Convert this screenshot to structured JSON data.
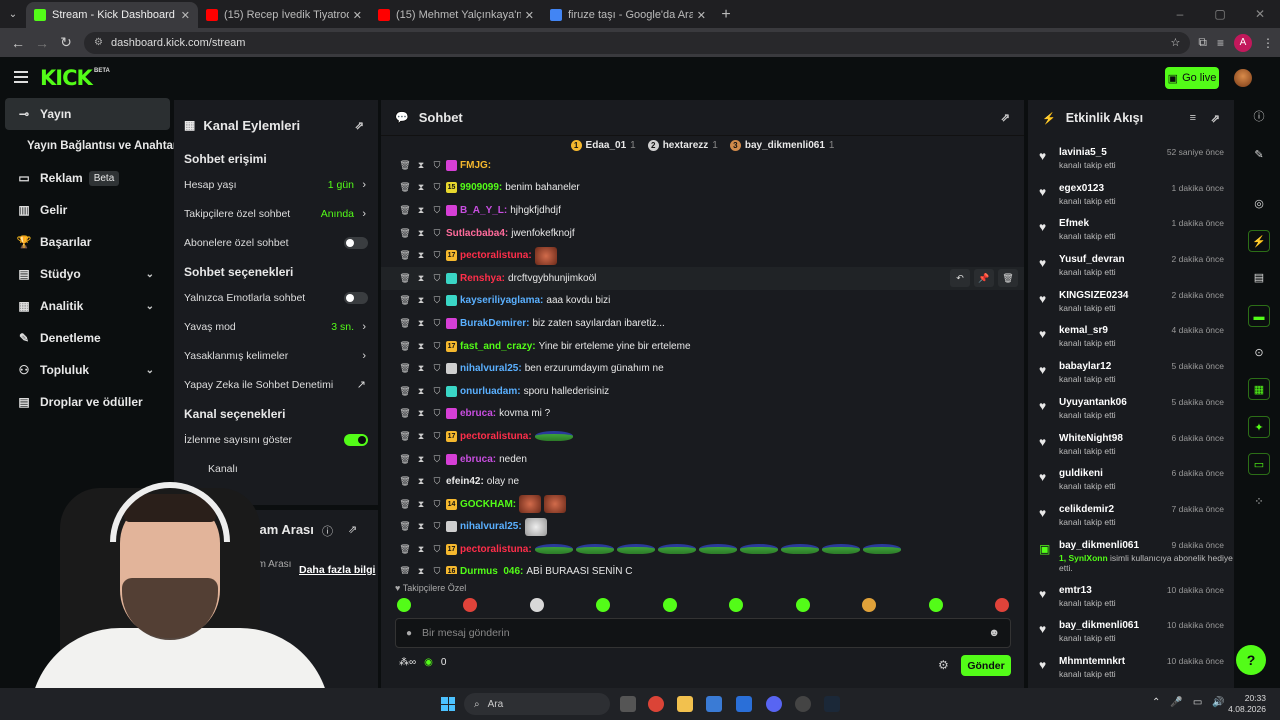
{
  "browser": {
    "tabs": [
      {
        "title": "Stream - Kick Dashboard",
        "color": "#53fc18",
        "active": true
      },
      {
        "title": "(15) Recep İvedik Tiyatroda. #re",
        "color": "#ff0000",
        "active": false
      },
      {
        "title": "(15) Mehmet Yalçınkaya'nın Mu",
        "color": "#ff0000",
        "active": false
      },
      {
        "title": "firuze taşı - Google'da Ara",
        "color": "#4285f4",
        "active": false
      }
    ],
    "url": "dashboard.kick.com/stream",
    "profile_initial": "A"
  },
  "header": {
    "logo": "KICK",
    "beta": "BETA",
    "go_live": "Go live"
  },
  "nav": {
    "items": [
      {
        "label": "Yayın",
        "icon": "link-icon",
        "active": true
      },
      {
        "label": "Yayın Bağlantısı ve Anahtarı",
        "sub": true
      },
      {
        "label": "Reklam",
        "icon": "monitor-icon",
        "badge": "Beta"
      },
      {
        "label": "Gelir",
        "icon": "chart-icon"
      },
      {
        "label": "Başarılar",
        "icon": "trophy-icon"
      },
      {
        "label": "Stüdyo",
        "icon": "studio-icon",
        "expand": true
      },
      {
        "label": "Analitik",
        "icon": "analytics-icon",
        "expand": true
      },
      {
        "label": "Denetleme",
        "icon": "wrench-icon"
      },
      {
        "label": "Topluluk",
        "icon": "community-icon",
        "expand": true
      },
      {
        "label": "Droplar ve ödüller",
        "icon": "drops-icon"
      }
    ]
  },
  "actions": {
    "title": "Kanal Eylemleri",
    "chat_access_title": "Sohbet erişimi",
    "account_age_label": "Hesap yaşı",
    "account_age_value": "1 gün",
    "followers_only_label": "Takipçilere özel sohbet",
    "followers_only_value": "Anında",
    "subs_only_label": "Abonelere özel sohbet",
    "chat_options_title": "Sohbet seçenekleri",
    "emote_only_label": "Yalnızca Emotlarla sohbet",
    "slow_mode_label": "Yavaş mod",
    "slow_mode_value": "3 sn.",
    "banned_words_label": "Yasaklanmış kelimeler",
    "ai_mod_label": "Yapay Zeka ile Sohbet Denetimi",
    "channel_options_title": "Kanal seçenekleri",
    "show_viewers_label": "İzlenme sayısını göster",
    "channel_partial": "Kanalı"
  },
  "adbreak": {
    "title": "Reklam Arası",
    "desc": "Reklam Arası ...ndi.",
    "link": "Daha fazla bilgi"
  },
  "chat": {
    "title": "Sohbet",
    "leaders": [
      {
        "rank": "1",
        "name": "Edaa_01",
        "count": "1",
        "color": "#f5b82e"
      },
      {
        "rank": "2",
        "name": "hextarezz",
        "count": "1",
        "color": "#cfcfcf"
      },
      {
        "rank": "3",
        "name": "bay_dikmenli061",
        "count": "1",
        "color": "#d08a4a"
      }
    ],
    "messages": [
      {
        "user": "FMJG:",
        "color": "#f5b82e",
        "text": "",
        "badge": "#d63fd6",
        "badge_text": "",
        "emote": ""
      },
      {
        "user": "9909099:",
        "color": "#53fc18",
        "text": "benim bahaneler",
        "badge": "#e8d82e",
        "badge_text": "15",
        "emote": ""
      },
      {
        "user": "B_A_Y_L:",
        "color": "#c84ee0",
        "text": "hjhgkfjdhdjf",
        "badge": "#d63fd6",
        "badge_text": "",
        "emote": ""
      },
      {
        "user": "Sutlacbaba4:",
        "color": "#ff6b9b",
        "text": "jwenfokefknojf",
        "badge": "",
        "badge_text": "",
        "emote": ""
      },
      {
        "user": "pectoralistuna:",
        "color": "#ff2e4a",
        "text": "",
        "badge": "#f5b82e",
        "badge_text": "17",
        "emote": "face"
      },
      {
        "user": "Renshya:",
        "color": "#ff2e4a",
        "text": "drcftvgybhunjimkoöl",
        "badge": "#3ad6c6",
        "badge_text": "",
        "emote": "",
        "hl": true
      },
      {
        "user": "kayseriliyaglama:",
        "color": "#5ab0ff",
        "text": "aaa kovdu bizi",
        "badge": "#3ad6c6",
        "badge_text": "",
        "emote": ""
      },
      {
        "user": "BurakDemirer:",
        "color": "#5ab0ff",
        "text": "biz zaten sayılardan ibaretiz...",
        "badge": "#d63fd6",
        "badge_text": "",
        "emote": ""
      },
      {
        "user": "fast_and_crazy:",
        "color": "#53fc18",
        "text": "Yine bir erteleme yine bir erteleme",
        "badge": "#f5b82e",
        "badge_text": "17",
        "emote": ""
      },
      {
        "user": "nihalvural25:",
        "color": "#5ab0ff",
        "text": "ben erzurumdayım günahım ne",
        "badge": "#cfcfcf",
        "badge_text": "",
        "emote": ""
      },
      {
        "user": "onurluadam:",
        "color": "#5ab0ff",
        "text": "sporu hallederisiniz",
        "badge": "#3ad6c6",
        "badge_text": "",
        "emote": ""
      },
      {
        "user": "ebruca:",
        "color": "#c84ee0",
        "text": "kovma mi ?",
        "badge": "#d63fd6",
        "badge_text": "",
        "emote": ""
      },
      {
        "user": "pectoralistuna:",
        "color": "#ff2e4a",
        "text": "",
        "badge": "#f5b82e",
        "badge_text": "17",
        "emote": "pepe"
      },
      {
        "user": "ebruca:",
        "color": "#c84ee0",
        "text": "neden",
        "badge": "#d63fd6",
        "badge_text": "",
        "emote": ""
      },
      {
        "user": "efein42:",
        "color": "#e8e8e8",
        "text": "olay ne",
        "badge": "",
        "badge_text": "",
        "emote": ""
      },
      {
        "user": "GOCKHAM:",
        "color": "#53fc18",
        "text": "",
        "badge": "#f5b82e",
        "badge_text": "14",
        "emote": "face2"
      },
      {
        "user": "nihalvural25:",
        "color": "#5ab0ff",
        "text": "",
        "badge": "#cfcfcf",
        "badge_text": "",
        "emote": "cat"
      },
      {
        "user": "pectoralistuna:",
        "color": "#ff2e4a",
        "text": "",
        "badge": "#f5b82e",
        "badge_text": "17",
        "emote": "pepe9"
      },
      {
        "user": "Durmus_046:",
        "color": "#53fc18",
        "text": "ABİ BURAASI SENİN Ç",
        "badge": "#f5b82e",
        "badge_text": "16",
        "emote": ""
      }
    ],
    "followers_only": "Takipçilere Özel",
    "input_placeholder": "Bir mesaj gönderin",
    "points": "0",
    "send": "Gönder"
  },
  "activity": {
    "title": "Etkinlik Akışı",
    "items": [
      {
        "name": "lavinia5_5",
        "desc": "kanalı takip etti",
        "time": "52 saniye önce"
      },
      {
        "name": "egex0123",
        "desc": "kanalı takip etti",
        "time": "1 dakika önce"
      },
      {
        "name": "Efmek",
        "desc": "kanalı takip etti",
        "time": "1 dakika önce"
      },
      {
        "name": "Yusuf_devran",
        "desc": "kanalı takip etti",
        "time": "2 dakika önce"
      },
      {
        "name": "KINGSIZE0234",
        "desc": "kanalı takip etti",
        "time": "2 dakika önce"
      },
      {
        "name": "kemal_sr9",
        "desc": "kanalı takip etti",
        "time": "4 dakika önce"
      },
      {
        "name": "babaylar12",
        "desc": "kanalı takip etti",
        "time": "5 dakika önce"
      },
      {
        "name": "Uyuyantank06",
        "desc": "kanalı takip etti",
        "time": "5 dakika önce"
      },
      {
        "name": "WhiteNight98",
        "desc": "kanalı takip etti",
        "time": "6 dakika önce"
      },
      {
        "name": "guldikeni",
        "desc": "kanalı takip etti",
        "time": "6 dakika önce"
      },
      {
        "name": "celikdemir2",
        "desc": "kanalı takip etti",
        "time": "7 dakika önce"
      },
      {
        "name": "bay_dikmenli061",
        "desc_prefix": "1, SynlXonn",
        "desc": " isimli kullanıcıya abonelik hediye etti.",
        "time": "9 dakika önce",
        "sub": true
      },
      {
        "name": "emtr13",
        "desc": "kanalı takip etti",
        "time": "10 dakika önce"
      },
      {
        "name": "bay_dikmenli061",
        "desc": "kanalı takip etti",
        "time": "10 dakika önce"
      },
      {
        "name": "Mhmntemnkrt",
        "desc": "kanalı takip etti",
        "time": "10 dakika önce"
      }
    ]
  },
  "taskbar": {
    "search": "Ara",
    "time": "20:33",
    "date": "4.08.2026"
  }
}
